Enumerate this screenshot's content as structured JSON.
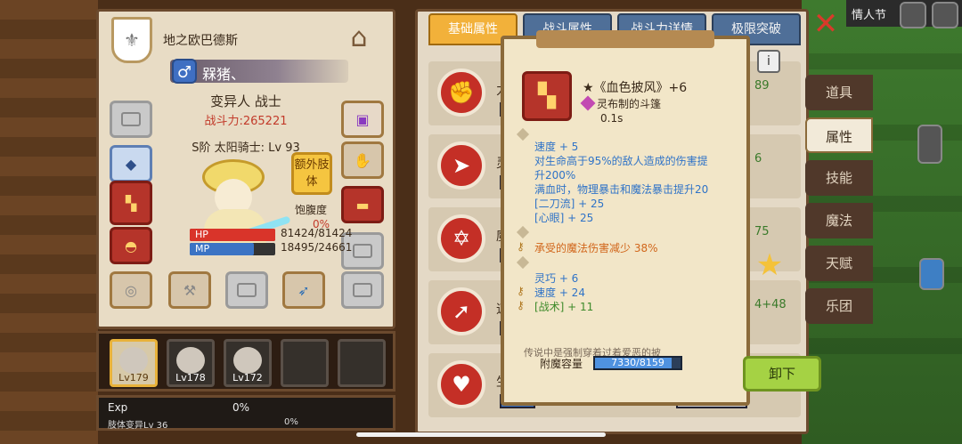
{
  "scene": {
    "holiday_label": "情人节"
  },
  "character": {
    "guild_name": "地之欧巴德斯",
    "player_name": "槑猪、",
    "race_class": "变异人 战士",
    "power": "战斗力:265221",
    "rank_level": "S阶 太阳骑士: Lv 93",
    "extra_body_label": "额外肢体",
    "satiety_label": "饱腹度",
    "satiety_value": "0%",
    "hp": {
      "label": "HP",
      "value": "81424/81424",
      "fill": 1.0
    },
    "mp": {
      "label": "MP",
      "value": "18495/24661",
      "fill": 0.75
    }
  },
  "party": [
    {
      "level": "Lv179",
      "selected": true
    },
    {
      "level": "Lv178",
      "selected": false
    },
    {
      "level": "Lv172",
      "selected": false
    },
    {
      "level": "",
      "selected": false
    },
    {
      "level": "",
      "selected": false
    }
  ],
  "exp": {
    "label": "Exp",
    "value": "0%",
    "sub_label": "肢体变异Lv 36",
    "sub_value": "0%"
  },
  "tabs": [
    "基础属性",
    "战斗属性",
    "战斗力详情",
    "极限突破"
  ],
  "side_menu": [
    "道具",
    "属性",
    "技能",
    "魔法",
    "天赋",
    "乐团"
  ],
  "attr_rows": [
    {
      "icon": "strength-icon",
      "stub": "力",
      "num": "89"
    },
    {
      "icon": "agility-icon",
      "stub": "灵",
      "num": "6"
    },
    {
      "icon": "magic-icon",
      "stub": "魔",
      "num": "75"
    },
    {
      "icon": "speed-icon",
      "stub": "速",
      "num": "4+48"
    },
    {
      "icon": "vitality-icon",
      "stub": "生",
      "num": ""
    }
  ],
  "item": {
    "name": "★《血色披风》+6",
    "type": "灵布制的斗篷",
    "time": "0.1s",
    "lines_blue": [
      "速度 + 5",
      "对生命高于95%的敌人造成的伤害提",
      "升200%",
      "满血时，物理暴击和魔法暴击提升20",
      "[二刀流] + 25",
      "[心眼] + 25"
    ],
    "line_orange": "承受的魔法伤害减少 38%",
    "lines_blue_2": [
      "灵巧 + 6",
      "速度 + 24"
    ],
    "line_green": "[战术] + 11",
    "cut_text": "传说中是强制穿着过着爱恶的披",
    "capacity_label": "附魔容量",
    "capacity_value": "7330/8159",
    "capacity_fill": 0.898
  },
  "buttons": {
    "unequip": "卸下"
  }
}
